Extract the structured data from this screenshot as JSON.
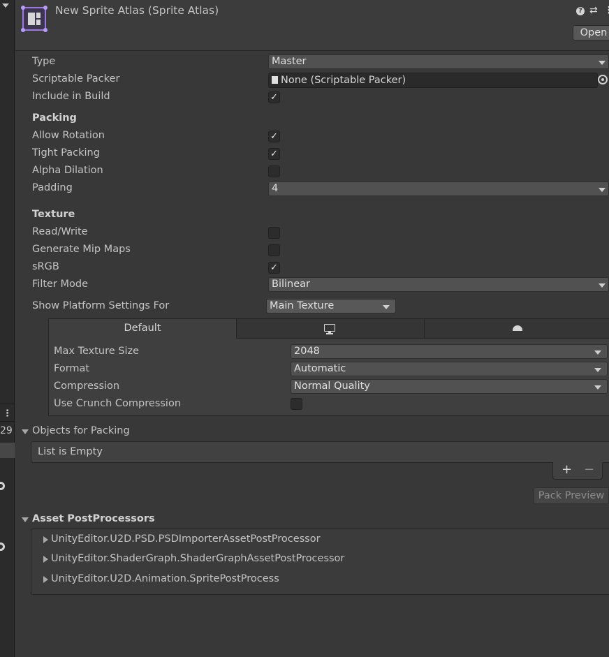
{
  "header": {
    "title": "New Sprite Atlas (Sprite Atlas)",
    "open_label": "Open",
    "help_glyph": "?",
    "preset_glyph": "⇄",
    "menu_glyph": "⋮"
  },
  "left_strip": {
    "number": "29",
    "kebab_glyph": "⋮"
  },
  "fields": {
    "type": {
      "label": "Type",
      "value": "Master"
    },
    "scriptable_packer": {
      "label": "Scriptable Packer",
      "value": "None (Scriptable Packer)"
    },
    "include_in_build": {
      "label": "Include in Build",
      "checked": true
    }
  },
  "packing": {
    "header": "Packing",
    "allow_rotation": {
      "label": "Allow Rotation",
      "checked": true
    },
    "tight_packing": {
      "label": "Tight Packing",
      "checked": true
    },
    "alpha_dilation": {
      "label": "Alpha Dilation",
      "checked": false
    },
    "padding": {
      "label": "Padding",
      "value": "4"
    }
  },
  "texture": {
    "header": "Texture",
    "read_write": {
      "label": "Read/Write",
      "checked": false
    },
    "generate_mip_maps": {
      "label": "Generate Mip Maps",
      "checked": false
    },
    "srgb": {
      "label": "sRGB",
      "checked": true
    },
    "filter_mode": {
      "label": "Filter Mode",
      "value": "Bilinear"
    }
  },
  "platform": {
    "label": "Show Platform Settings For",
    "value": "Main Texture",
    "tabs": {
      "default": "Default",
      "standalone_icon": "monitor-icon",
      "android_icon": "android-icon"
    },
    "max_texture_size": {
      "label": "Max Texture Size",
      "value": "2048"
    },
    "format": {
      "label": "Format",
      "value": "Automatic"
    },
    "compression": {
      "label": "Compression",
      "value": "Normal Quality"
    },
    "use_crunch": {
      "label": "Use Crunch Compression",
      "checked": false
    }
  },
  "objects_for_packing": {
    "header": "Objects for Packing",
    "empty_text": "List is Empty",
    "add_glyph": "+",
    "remove_glyph": "−"
  },
  "pack_preview_label": "Pack Preview",
  "asset_postprocessors": {
    "header": "Asset PostProcessors",
    "items": [
      "UnityEditor.U2D.PSD.PSDImporterAssetPostProcessor",
      "UnityEditor.ShaderGraph.ShaderGraphAssetPostProcessor",
      "UnityEditor.U2D.Animation.SpritePostProcess"
    ]
  },
  "colors": {
    "background": "#383838",
    "header": "#3c3c3c",
    "atlas_icon_accent": "#9a7ae0",
    "text": "#c4c4c4"
  }
}
